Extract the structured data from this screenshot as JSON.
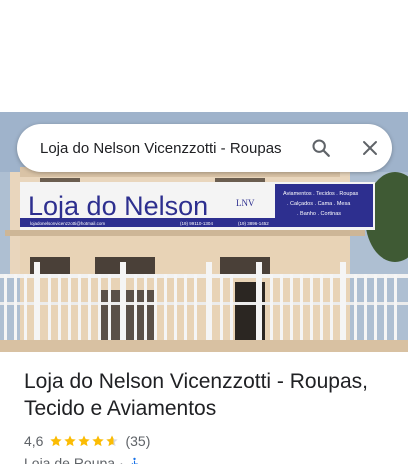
{
  "search": {
    "query": "Loja do Nelson Vicenzzotti - Roupas",
    "search_icon": "search-icon",
    "close_icon": "close-icon"
  },
  "photo": {
    "sign_main": "Loja do Nelson",
    "sign_logo": "LNV",
    "sign_side_lines": [
      "Aviamentos . Tecidos . Roupas",
      ". Calçados . Cama . Mesa",
      ". Banho . Cortinas"
    ],
    "sign_email": "lojadonelsonvicenzzotti@hotmail.com",
    "sign_phone_1": "(19) 99110-1304",
    "sign_phone_2": "(19) 3896-1452"
  },
  "place": {
    "title": "Loja do Nelson Vicenzzotti - Roupas, Tecido e Aviamentos",
    "rating": "4,6",
    "rating_stars_value": 4.6,
    "reviews": "(35)",
    "category": "Loja de Roupa",
    "separator": "·",
    "accessibility_icon": "wheelchair-icon"
  },
  "colors": {
    "star": "#fbbc04",
    "accessibility": "#1a73e8",
    "sign_blue": "#2d2f8f"
  }
}
